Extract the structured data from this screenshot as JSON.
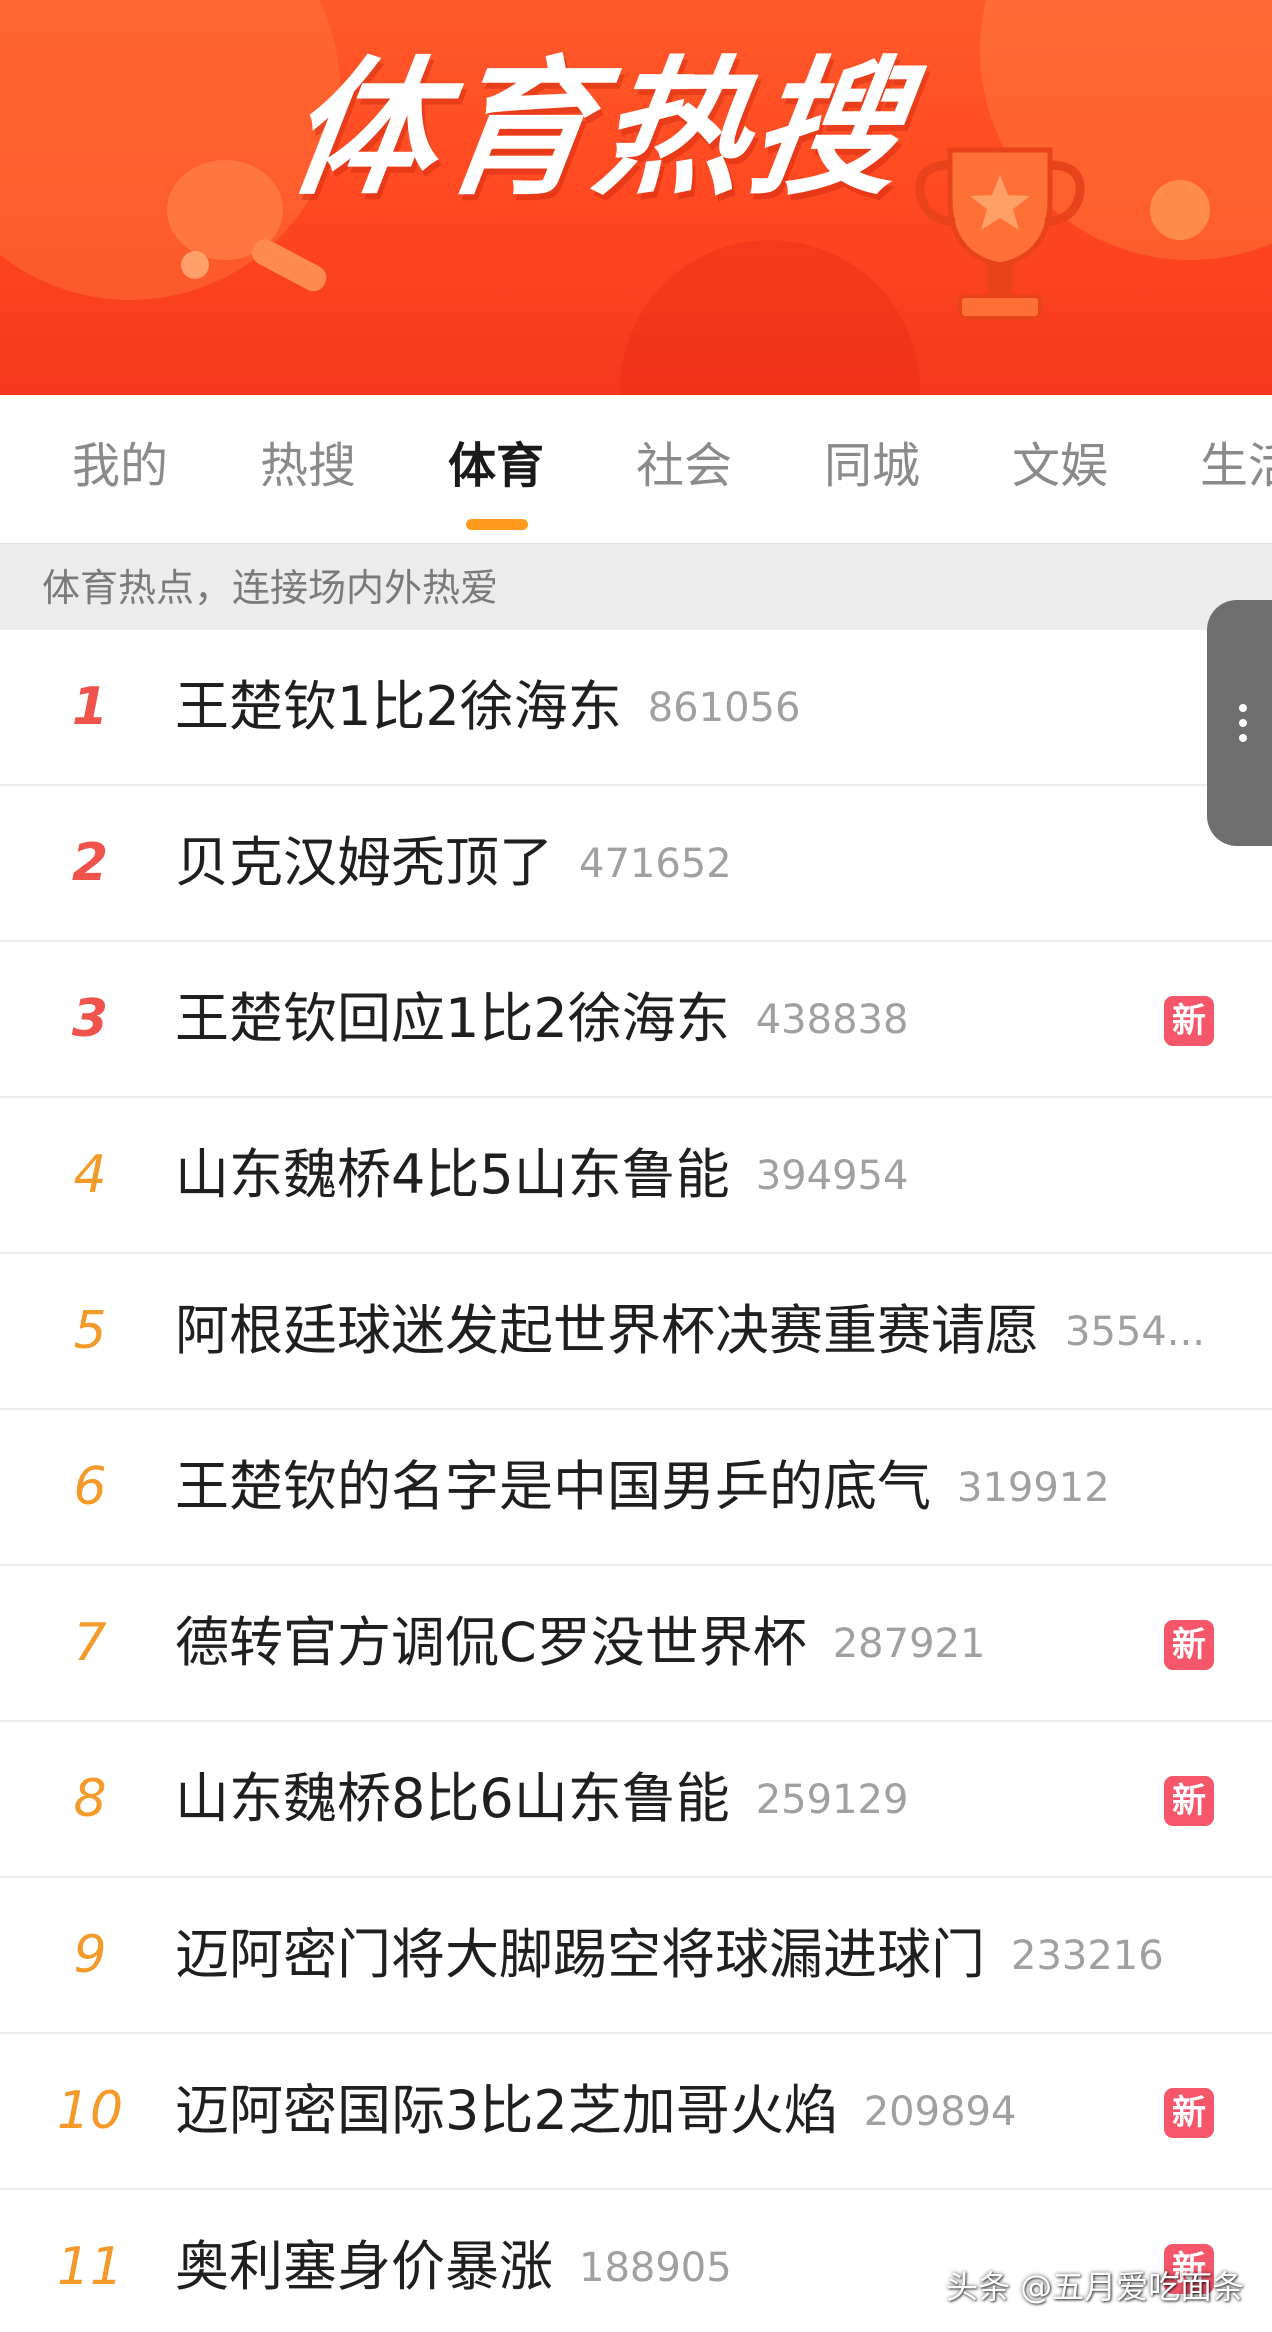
{
  "banner": {
    "title": "体育热搜",
    "accent_color": "#ff4a22"
  },
  "tabs": [
    {
      "label": "我的",
      "active": false
    },
    {
      "label": "热搜",
      "active": false
    },
    {
      "label": "体育",
      "active": true
    },
    {
      "label": "社会",
      "active": false
    },
    {
      "label": "同城",
      "active": false
    },
    {
      "label": "文娱",
      "active": false
    },
    {
      "label": "生活",
      "active": false
    }
  ],
  "subtitle": "体育热点，连接场内外热爱",
  "hot_list": [
    {
      "rank": "1",
      "title": "王楚钦1比2徐海东",
      "count": "861056",
      "badge": ""
    },
    {
      "rank": "2",
      "title": "贝克汉姆秃顶了",
      "count": "471652",
      "badge": ""
    },
    {
      "rank": "3",
      "title": "王楚钦回应1比2徐海东",
      "count": "438838",
      "badge": "新"
    },
    {
      "rank": "4",
      "title": "山东魏桥4比5山东鲁能",
      "count": "394954",
      "badge": ""
    },
    {
      "rank": "5",
      "title": "阿根廷球迷发起世界杯决赛重赛请愿",
      "count": "3554...",
      "badge": ""
    },
    {
      "rank": "6",
      "title": "王楚钦的名字是中国男乒的底气",
      "count": "319912",
      "badge": ""
    },
    {
      "rank": "7",
      "title": "德转官方调侃C罗没世界杯",
      "count": "287921",
      "badge": "新"
    },
    {
      "rank": "8",
      "title": "山东魏桥8比6山东鲁能",
      "count": "259129",
      "badge": "新"
    },
    {
      "rank": "9",
      "title": "迈阿密门将大脚踢空将球漏进球门",
      "count": "233216",
      "badge": ""
    },
    {
      "rank": "10",
      "title": "迈阿密国际3比2芝加哥火焰",
      "count": "209894",
      "badge": "新"
    },
    {
      "rank": "11",
      "title": "奥利塞身价暴涨",
      "count": "188905",
      "badge": "新"
    }
  ],
  "watermark": "头条 @五月爱吃面条",
  "colors": {
    "rank_top": "#f0524c",
    "rank_other": "#f39a2a",
    "badge_new": "#f5566a",
    "tab_indicator": "#ff9a1e"
  }
}
